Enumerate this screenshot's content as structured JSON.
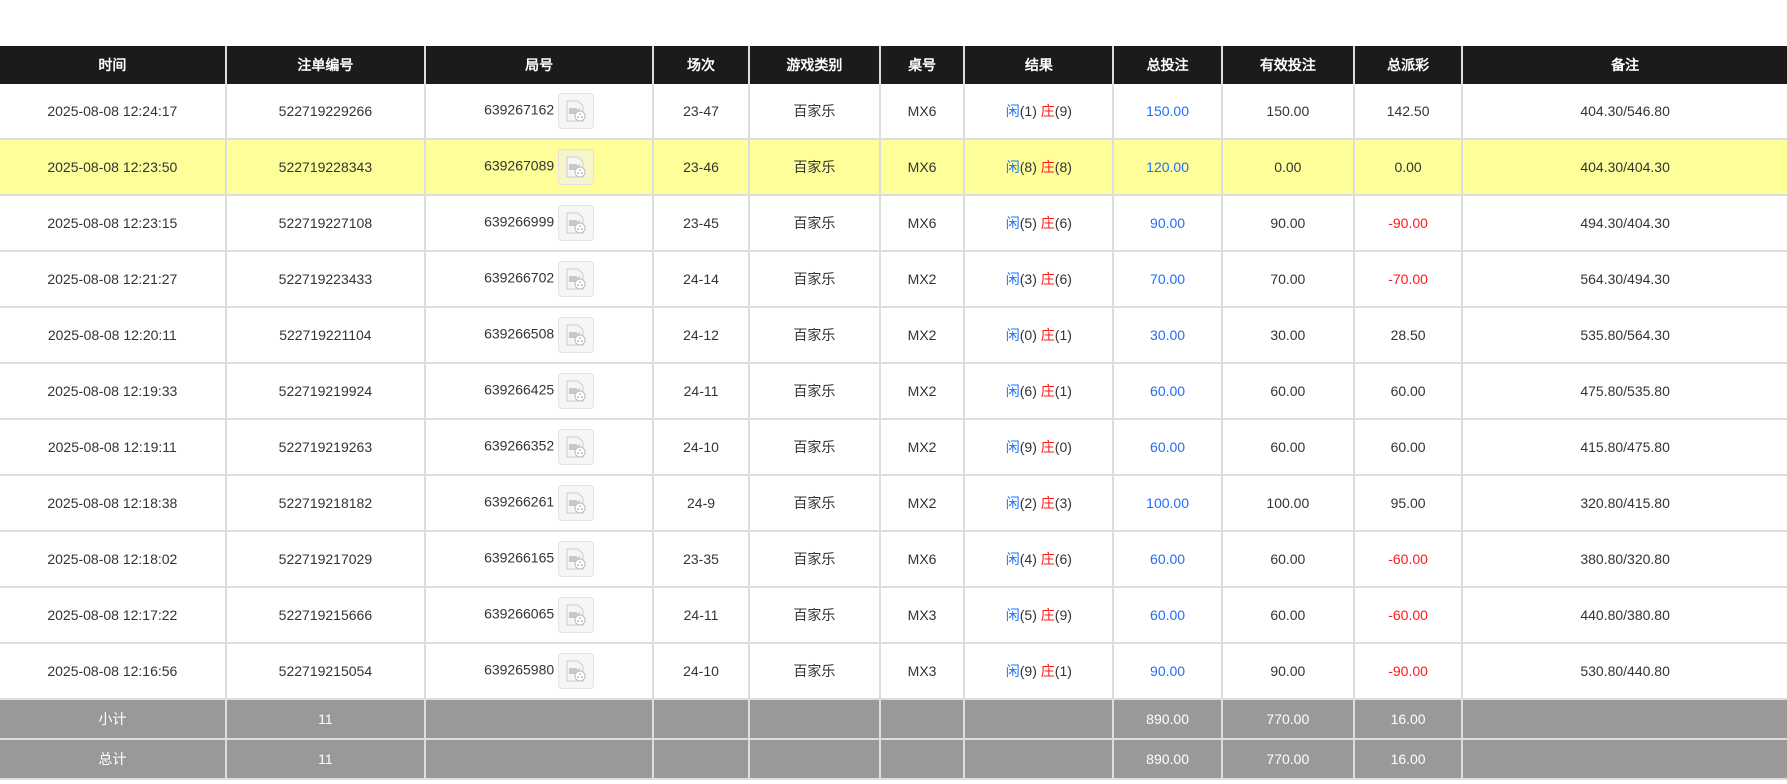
{
  "headers": [
    "时间",
    "注单编号",
    "局号",
    "场次",
    "游戏类别",
    "桌号",
    "结果",
    "总投注",
    "有效投注",
    "总派彩",
    "备注"
  ],
  "colors": {
    "header_bg": "#1b1b1b",
    "highlight": "#ffff99",
    "player": "#1e6fff",
    "banker": "#ff1a1a",
    "footer_bg": "#999999"
  },
  "rows": [
    {
      "time": "2025-08-08 12:24:17",
      "bet_id": "522719229266",
      "round": "639267162",
      "shoe": "23-47",
      "game": "百家乐",
      "table": "MX6",
      "player_label": "闲",
      "player": "(1)",
      "banker_label": "庄",
      "banker": "(9)",
      "bet": "150.00",
      "valid": "150.00",
      "payout": "142.50",
      "payout_negative": false,
      "note": "404.30/546.80",
      "highlighted": false
    },
    {
      "time": "2025-08-08 12:23:50",
      "bet_id": "522719228343",
      "round": "639267089",
      "shoe": "23-46",
      "game": "百家乐",
      "table": "MX6",
      "player_label": "闲",
      "player": "(8)",
      "banker_label": "庄",
      "banker": "(8)",
      "bet": "120.00",
      "valid": "0.00",
      "payout": "0.00",
      "payout_negative": false,
      "note": "404.30/404.30",
      "highlighted": true
    },
    {
      "time": "2025-08-08 12:23:15",
      "bet_id": "522719227108",
      "round": "639266999",
      "shoe": "23-45",
      "game": "百家乐",
      "table": "MX6",
      "player_label": "闲",
      "player": "(5)",
      "banker_label": "庄",
      "banker": "(6)",
      "bet": "90.00",
      "valid": "90.00",
      "payout": "-90.00",
      "payout_negative": true,
      "note": "494.30/404.30",
      "highlighted": false
    },
    {
      "time": "2025-08-08 12:21:27",
      "bet_id": "522719223433",
      "round": "639266702",
      "shoe": "24-14",
      "game": "百家乐",
      "table": "MX2",
      "player_label": "闲",
      "player": "(3)",
      "banker_label": "庄",
      "banker": "(6)",
      "bet": "70.00",
      "valid": "70.00",
      "payout": "-70.00",
      "payout_negative": true,
      "note": "564.30/494.30",
      "highlighted": false
    },
    {
      "time": "2025-08-08 12:20:11",
      "bet_id": "522719221104",
      "round": "639266508",
      "shoe": "24-12",
      "game": "百家乐",
      "table": "MX2",
      "player_label": "闲",
      "player": "(0)",
      "banker_label": "庄",
      "banker": "(1)",
      "bet": "30.00",
      "valid": "30.00",
      "payout": "28.50",
      "payout_negative": false,
      "note": "535.80/564.30",
      "highlighted": false
    },
    {
      "time": "2025-08-08 12:19:33",
      "bet_id": "522719219924",
      "round": "639266425",
      "shoe": "24-11",
      "game": "百家乐",
      "table": "MX2",
      "player_label": "闲",
      "player": "(6)",
      "banker_label": "庄",
      "banker": "(1)",
      "bet": "60.00",
      "valid": "60.00",
      "payout": "60.00",
      "payout_negative": false,
      "note": "475.80/535.80",
      "highlighted": false
    },
    {
      "time": "2025-08-08 12:19:11",
      "bet_id": "522719219263",
      "round": "639266352",
      "shoe": "24-10",
      "game": "百家乐",
      "table": "MX2",
      "player_label": "闲",
      "player": "(9)",
      "banker_label": "庄",
      "banker": "(0)",
      "bet": "60.00",
      "valid": "60.00",
      "payout": "60.00",
      "payout_negative": false,
      "note": "415.80/475.80",
      "highlighted": false
    },
    {
      "time": "2025-08-08 12:18:38",
      "bet_id": "522719218182",
      "round": "639266261",
      "shoe": "24-9",
      "game": "百家乐",
      "table": "MX2",
      "player_label": "闲",
      "player": "(2)",
      "banker_label": "庄",
      "banker": "(3)",
      "bet": "100.00",
      "valid": "100.00",
      "payout": "95.00",
      "payout_negative": false,
      "note": "320.80/415.80",
      "highlighted": false
    },
    {
      "time": "2025-08-08 12:18:02",
      "bet_id": "522719217029",
      "round": "639266165",
      "shoe": "23-35",
      "game": "百家乐",
      "table": "MX6",
      "player_label": "闲",
      "player": "(4)",
      "banker_label": "庄",
      "banker": "(6)",
      "bet": "60.00",
      "valid": "60.00",
      "payout": "-60.00",
      "payout_negative": true,
      "note": "380.80/320.80",
      "highlighted": false
    },
    {
      "time": "2025-08-08 12:17:22",
      "bet_id": "522719215666",
      "round": "639266065",
      "shoe": "24-11",
      "game": "百家乐",
      "table": "MX3",
      "player_label": "闲",
      "player": "(5)",
      "banker_label": "庄",
      "banker": "(9)",
      "bet": "60.00",
      "valid": "60.00",
      "payout": "-60.00",
      "payout_negative": true,
      "note": "440.80/380.80",
      "highlighted": false
    },
    {
      "time": "2025-08-08 12:16:56",
      "bet_id": "522719215054",
      "round": "639265980",
      "shoe": "24-10",
      "game": "百家乐",
      "table": "MX3",
      "player_label": "闲",
      "player": "(9)",
      "banker_label": "庄",
      "banker": "(1)",
      "bet": "90.00",
      "valid": "90.00",
      "payout": "-90.00",
      "payout_negative": true,
      "note": "530.80/440.80",
      "highlighted": false
    }
  ],
  "footer": [
    {
      "label": "小计",
      "count": "11",
      "bet": "890.00",
      "valid": "770.00",
      "payout": "16.00"
    },
    {
      "label": "总计",
      "count": "11",
      "bet": "890.00",
      "valid": "770.00",
      "payout": "16.00"
    }
  ]
}
